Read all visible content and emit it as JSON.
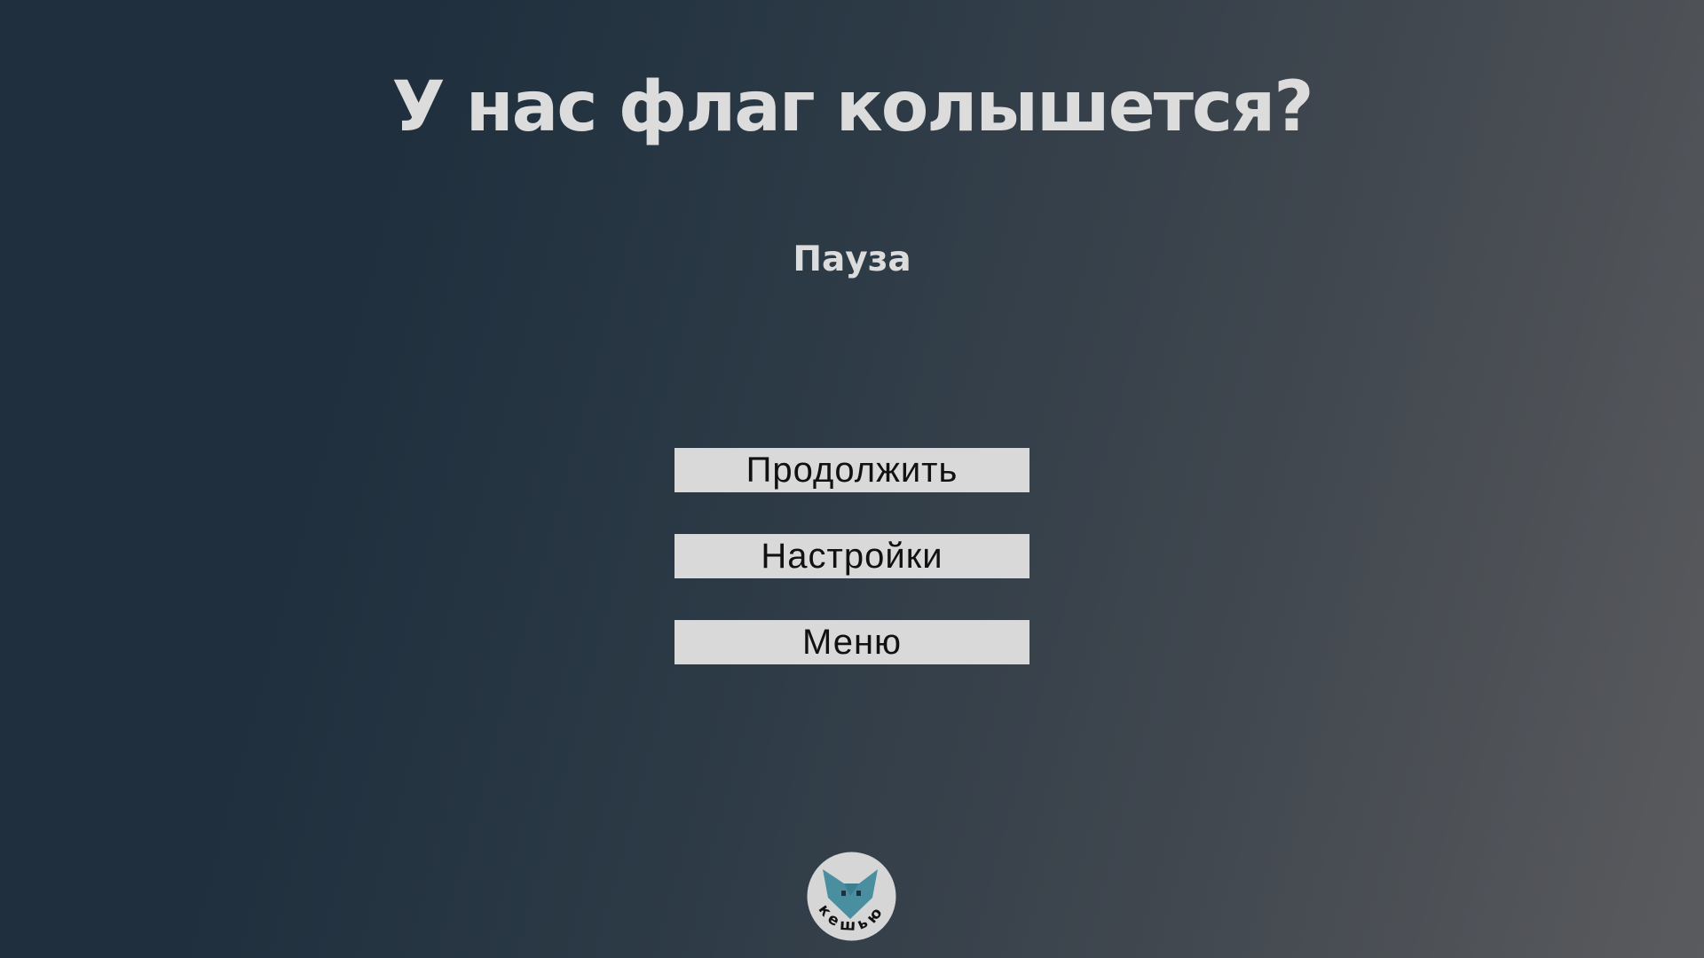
{
  "game": {
    "title": "У нас флаг колышется?"
  },
  "pause_screen": {
    "label": "Пауза",
    "buttons": {
      "continue_label": "Продолжить",
      "settings_label": "Настройки",
      "menu_label": "Меню"
    }
  },
  "logo": {
    "text": "кешью",
    "icon": "fox-head-icon"
  },
  "colors": {
    "text_light": "#dcdcdc",
    "button_bg": "#d9d9d9",
    "logo_fox": "#4a8fa0"
  }
}
